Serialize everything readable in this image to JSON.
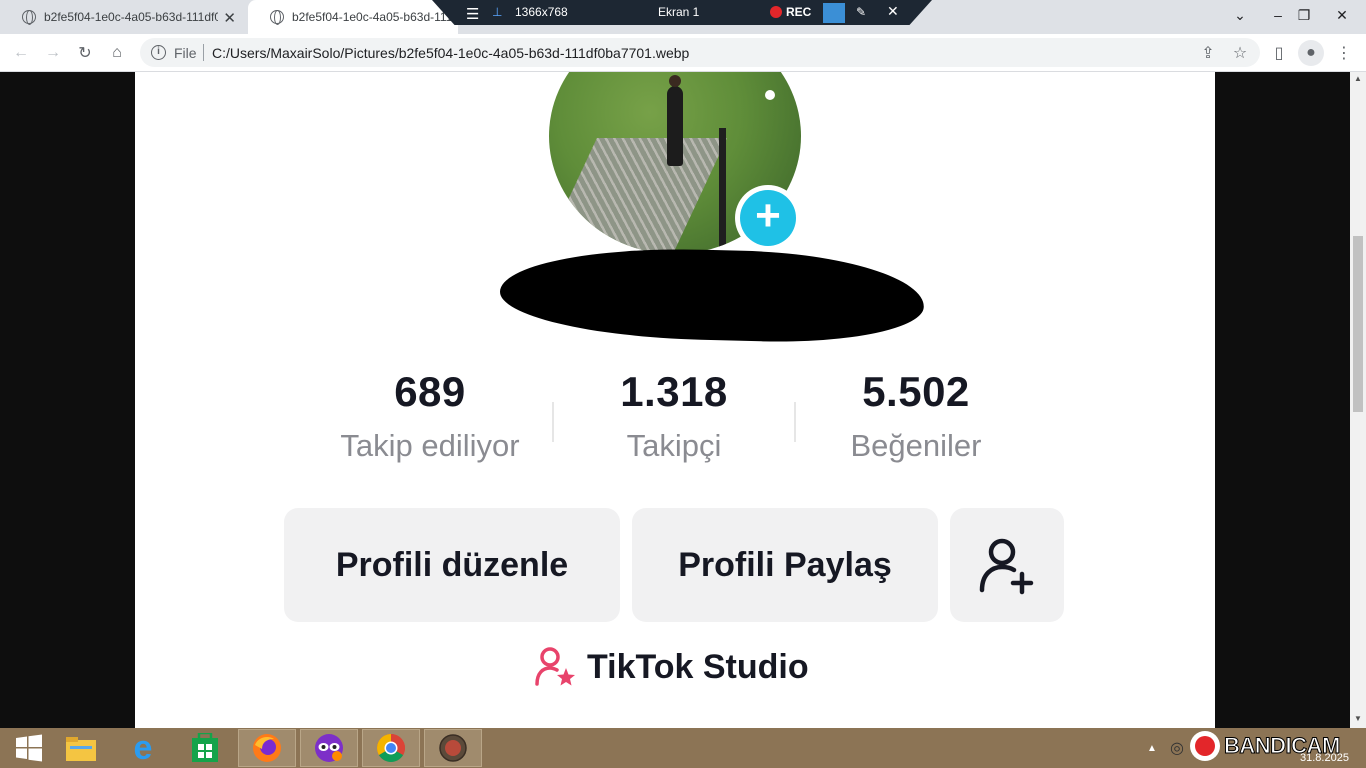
{
  "browser": {
    "tabs": [
      {
        "title": "b2fe5f04-1e0c-4a05-b63d-111df0ba7701.webp",
        "active": false
      },
      {
        "title": "b2fe5f04-1e0c-4a05-b63d-111df0ba7701.webp",
        "active": true
      }
    ],
    "address": {
      "scheme_label": "File",
      "url": "C:/Users/MaxairSolo/Pictures/b2fe5f04-1e0c-4a05-b63d-111df0ba7701.webp"
    }
  },
  "recorder": {
    "resolution": "1366x768",
    "target": "Ekran 1",
    "rec_label": "REC"
  },
  "profile": {
    "stats": [
      {
        "value": "689",
        "label": "Takip ediliyor"
      },
      {
        "value": "1.318",
        "label": "Takipçi"
      },
      {
        "value": "5.502",
        "label": "Beğeniler"
      }
    ],
    "buttons": {
      "edit": "Profili düzenle",
      "share": "Profili Paylaş"
    },
    "studio_label": "TikTok Studio",
    "colors": {
      "plus_button": "#1fc1e6",
      "studio_icon": "#e8436b",
      "text": "#161823",
      "muted": "#8a8b91"
    }
  },
  "taskbar": {
    "apps": [
      "start-icon",
      "file-explorer-icon",
      "internet-explorer-icon",
      "store-icon",
      "firefox-icon",
      "mask-app-icon",
      "chrome-icon",
      "bandicam-icon"
    ],
    "tray": {
      "brand": "BANDICAM",
      "date": "31.8.2025"
    }
  }
}
